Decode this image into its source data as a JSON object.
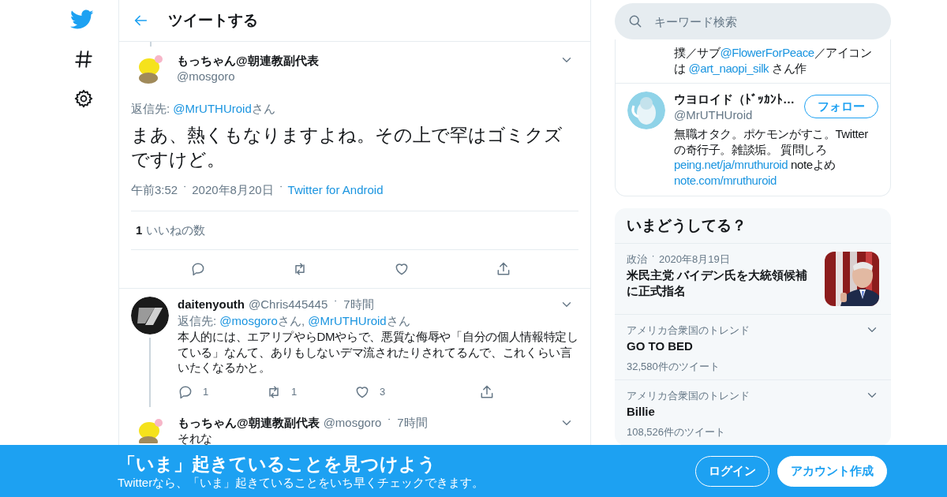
{
  "header": {
    "title": "ツイートする"
  },
  "main_tweet": {
    "author": "もっちゃん@朝連教副代表",
    "handle": "@mosgoro",
    "reply_to": [
      {
        "kind": "text",
        "text": "返信先: "
      },
      {
        "kind": "link",
        "text": "@MrUTHUroid"
      },
      {
        "kind": "text",
        "text": "さん"
      }
    ],
    "text": "まあ、熱くもなりますよね。その上で罕はゴミクズですけど。",
    "separator": "・",
    "time": "午前3:52",
    "date": "2020年8月20日",
    "source": "Twitter for Android",
    "likes_count": "1",
    "likes_label": "いいねの数",
    "actions": [
      {
        "kind": "reply"
      },
      {
        "kind": "retweet"
      },
      {
        "kind": "like"
      },
      {
        "kind": "share"
      }
    ]
  },
  "replies": [
    {
      "author": "daitenyouth",
      "handle": "@Chris445445",
      "separator": "・",
      "time": "7時間",
      "thread_line": true,
      "reply_to": [
        {
          "kind": "text",
          "text": "返信先: "
        },
        {
          "kind": "link",
          "text": "@mosgoro"
        },
        {
          "kind": "text",
          "text": "さん, "
        },
        {
          "kind": "link",
          "text": "@MrUTHUroid"
        },
        {
          "kind": "text",
          "text": "さん"
        }
      ],
      "text": "本人的には、エアリプやらDMやらで、悪質な侮辱や「自分の個人情報特定している」なんて、ありもしないデマ流されたりされてるんで、これくらい言いたくなるかと。",
      "actions": [
        {
          "kind": "reply",
          "count": "1"
        },
        {
          "kind": "retweet",
          "count": "1"
        },
        {
          "kind": "like",
          "count": "3"
        },
        {
          "kind": "share"
        }
      ]
    },
    {
      "author": "もっちゃん@朝連教副代表",
      "handle": "@mosgoro",
      "separator": "・",
      "time": "7時間",
      "thread_line": false,
      "text": "それな"
    }
  ],
  "sidebar": {
    "search": {
      "placeholder": "キーワード検索"
    },
    "users": [
      {
        "bio": [
          {
            "kind": "text",
            "text": "撲／サブ"
          },
          {
            "kind": "link",
            "text": "@FlowerForPeace"
          },
          {
            "kind": "text",
            "text": "／アイコンは "
          },
          {
            "kind": "link",
            "text": "@art_naopi_silk"
          },
          {
            "kind": "text",
            "text": " さん作"
          }
        ]
      },
      {
        "name": "ウヨロイド（ﾄﾞｯｶﾝﾄ…",
        "handle": "@MrUTHUroid",
        "follow_label": "フォロー",
        "bio": [
          {
            "kind": "text",
            "text": "無職オタク。ポケモンがすこ。Twitterの奇行子。雑談垢。 質問しろ"
          },
          {
            "kind": "link",
            "text": "peing.net/ja/mruthuroid"
          },
          {
            "kind": "text",
            "text": " noteよめ"
          },
          {
            "kind": "link",
            "text": "note.com/mruthuroid"
          }
        ]
      }
    ],
    "trends": {
      "title": "いまどうしてる？",
      "items": [
        {
          "kind": "news",
          "category": "政治",
          "separator": "・",
          "date": "2020年8月19日",
          "title": "米民主党 バイデン氏を大統領候補に正式指名"
        },
        {
          "kind": "trend",
          "context": "アメリカ合衆国のトレンド",
          "name": "GO TO BED",
          "count": "32,580件のツイート"
        },
        {
          "kind": "trend",
          "context": "アメリカ合衆国のトレンド",
          "name": "Billie",
          "count": "108,526件のツイート"
        }
      ]
    }
  },
  "banner": {
    "title": "「いま」起きていることを見つけよう",
    "subtitle": "Twitterなら、「いま」起きていることをいち早くチェックできます。",
    "buttons": [
      {
        "kind": "outline",
        "label": "ログイン"
      },
      {
        "kind": "filled",
        "label": "アカウント作成"
      }
    ]
  }
}
